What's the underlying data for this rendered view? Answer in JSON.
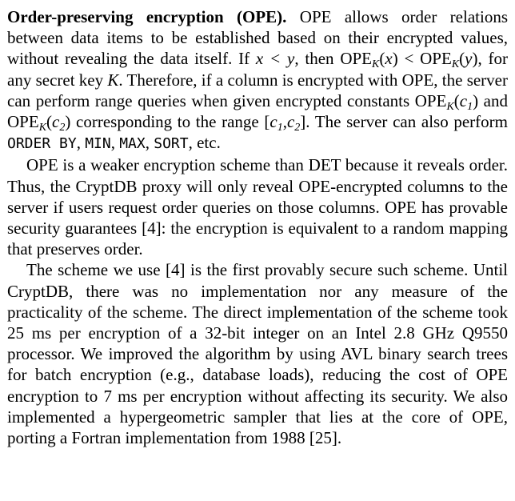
{
  "section": {
    "heading": "Order-preserving encryption (OPE).",
    "paragraphs": [
      {
        "id": "p1",
        "segments": [
          {
            "t": "text",
            "v": " OPE allows order rela­tions between data items to be established based on their en­crypted values, without revealing the data itself. If "
          },
          {
            "t": "math",
            "v": "x < y"
          },
          {
            "t": "text",
            "v": ", then "
          },
          {
            "t": "op",
            "v": "OPE",
            "sub": "K",
            "arg": "x"
          },
          {
            "t": "text",
            "v": " < "
          },
          {
            "t": "op",
            "v": "OPE",
            "sub": "K",
            "arg": "y"
          },
          {
            "t": "text",
            "v": ", for any secret key "
          },
          {
            "t": "math",
            "v": "K"
          },
          {
            "t": "text",
            "v": ". Therefore, if a column is encrypted with OPE, the server can perform range queries when given encrypted constants "
          },
          {
            "t": "op",
            "v": "OPE",
            "sub": "K",
            "arg": "c",
            "argsub": "1"
          },
          {
            "t": "text",
            "v": " and "
          },
          {
            "t": "op",
            "v": "OPE",
            "sub": "K",
            "arg": "c",
            "argsub": "2"
          },
          {
            "t": "text",
            "v": " corresponding to the range "
          },
          {
            "t": "range",
            "a": "c",
            "asub": "1",
            "b": "c",
            "bsub": "2"
          },
          {
            "t": "text",
            "v": ". The server can also perform "
          },
          {
            "t": "code",
            "v": "ORDER BY"
          },
          {
            "t": "text",
            "v": ", "
          },
          {
            "t": "code",
            "v": "MIN"
          },
          {
            "t": "text",
            "v": ", "
          },
          {
            "t": "code",
            "v": "MAX"
          },
          {
            "t": "text",
            "v": ", "
          },
          {
            "t": "code",
            "v": "SORT"
          },
          {
            "t": "text",
            "v": ", etc."
          }
        ]
      },
      {
        "id": "p2",
        "segments": [
          {
            "t": "text",
            "v": "OPE is a weaker encryption scheme than DET because it reveals order. Thus, the CryptDB proxy will only reveal OPE-encrypted columns to the server if users request order queries on those columns. OPE has provable security guarantees [4]: the encryption is equiva­lent to a random mapping that preserves order."
          }
        ]
      },
      {
        "id": "p3",
        "segments": [
          {
            "t": "text",
            "v": "The scheme we use [4] is the first provably secure such scheme. Until CryptDB, there was no implementation nor any measure of the practicality of the scheme. The direct implementation of the scheme took 25 ms per encryption of a 32-bit integer on an Intel 2.8 GHz Q9550 processor. We improved the algorithm by using AVL binary search trees for batch encryption (e.g., database loads), reducing the cost of OPE encryption to 7 ms per encryption without affecting its security. We also implemented a hypergeometric sampler that lies at the core of OPE, porting a Fortran implementation from 1988 [25]."
          }
        ]
      }
    ]
  }
}
